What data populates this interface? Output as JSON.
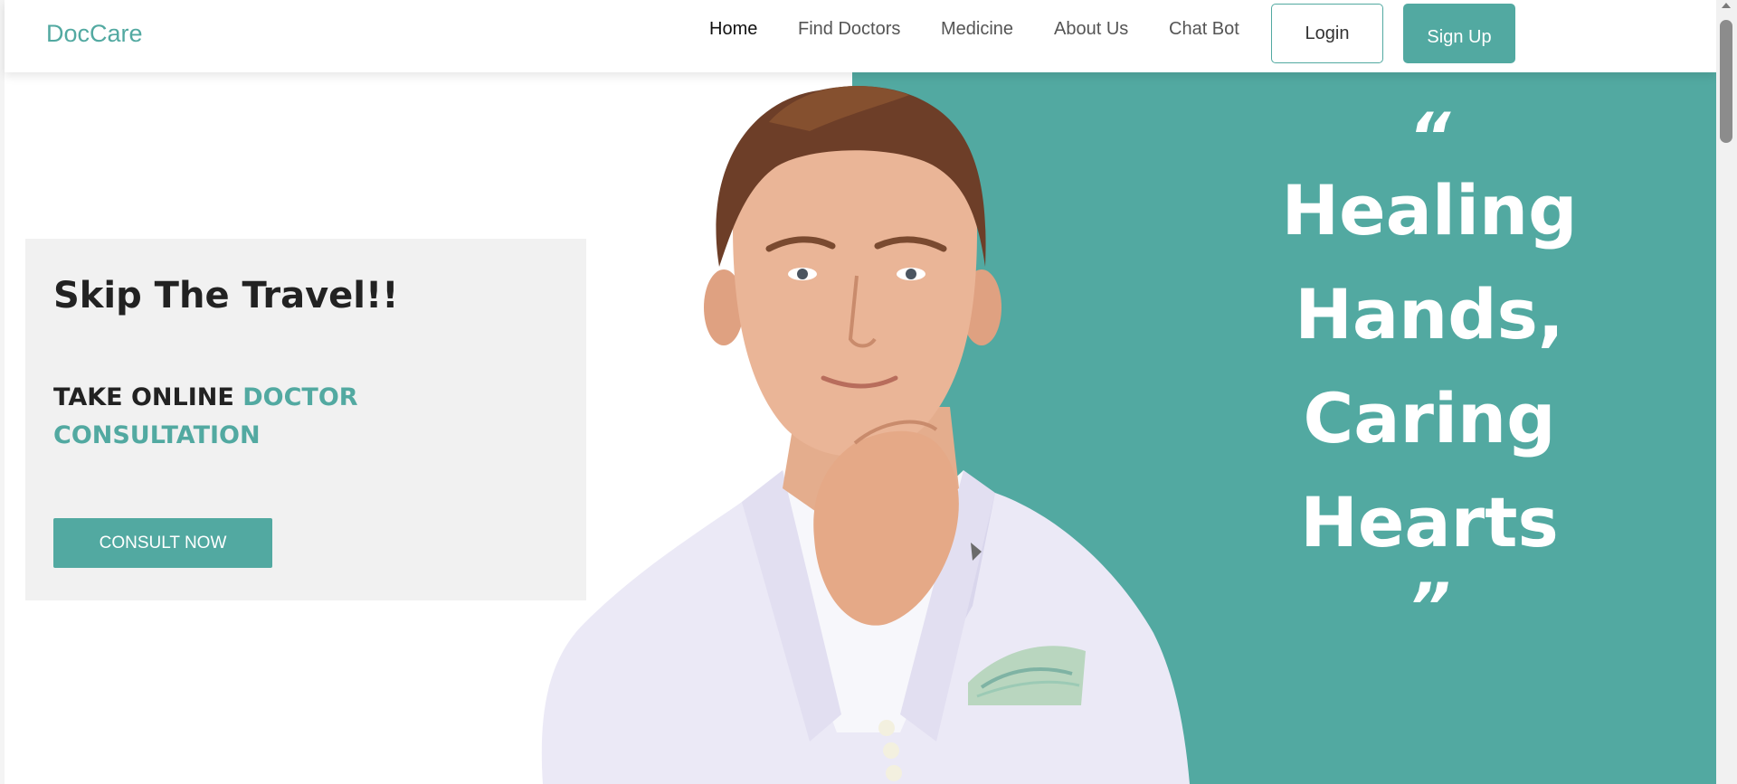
{
  "navbar": {
    "brand": "DocCare",
    "links": [
      {
        "label": "Home",
        "active": true
      },
      {
        "label": "Find Doctors",
        "active": false
      },
      {
        "label": "Medicine",
        "active": false
      },
      {
        "label": "About Us",
        "active": false
      },
      {
        "label": "Chat Bot",
        "active": false
      }
    ],
    "login_label": "Login",
    "signup_label": "Sign Up"
  },
  "hero": {
    "card_title": "Skip The Travel!!",
    "subtitle_plain": "TAKE ONLINE ",
    "subtitle_accent": "DOCTOR CONSULTATION",
    "cta_label": "CONSULT NOW",
    "quote_open": "“",
    "quote_lines": [
      "Healing",
      "Hands,",
      "Caring",
      "Hearts"
    ],
    "quote_close": "”"
  },
  "colors": {
    "accent": "#52a9a1",
    "card_bg": "#f1f1f1",
    "text_dark": "#222222"
  }
}
